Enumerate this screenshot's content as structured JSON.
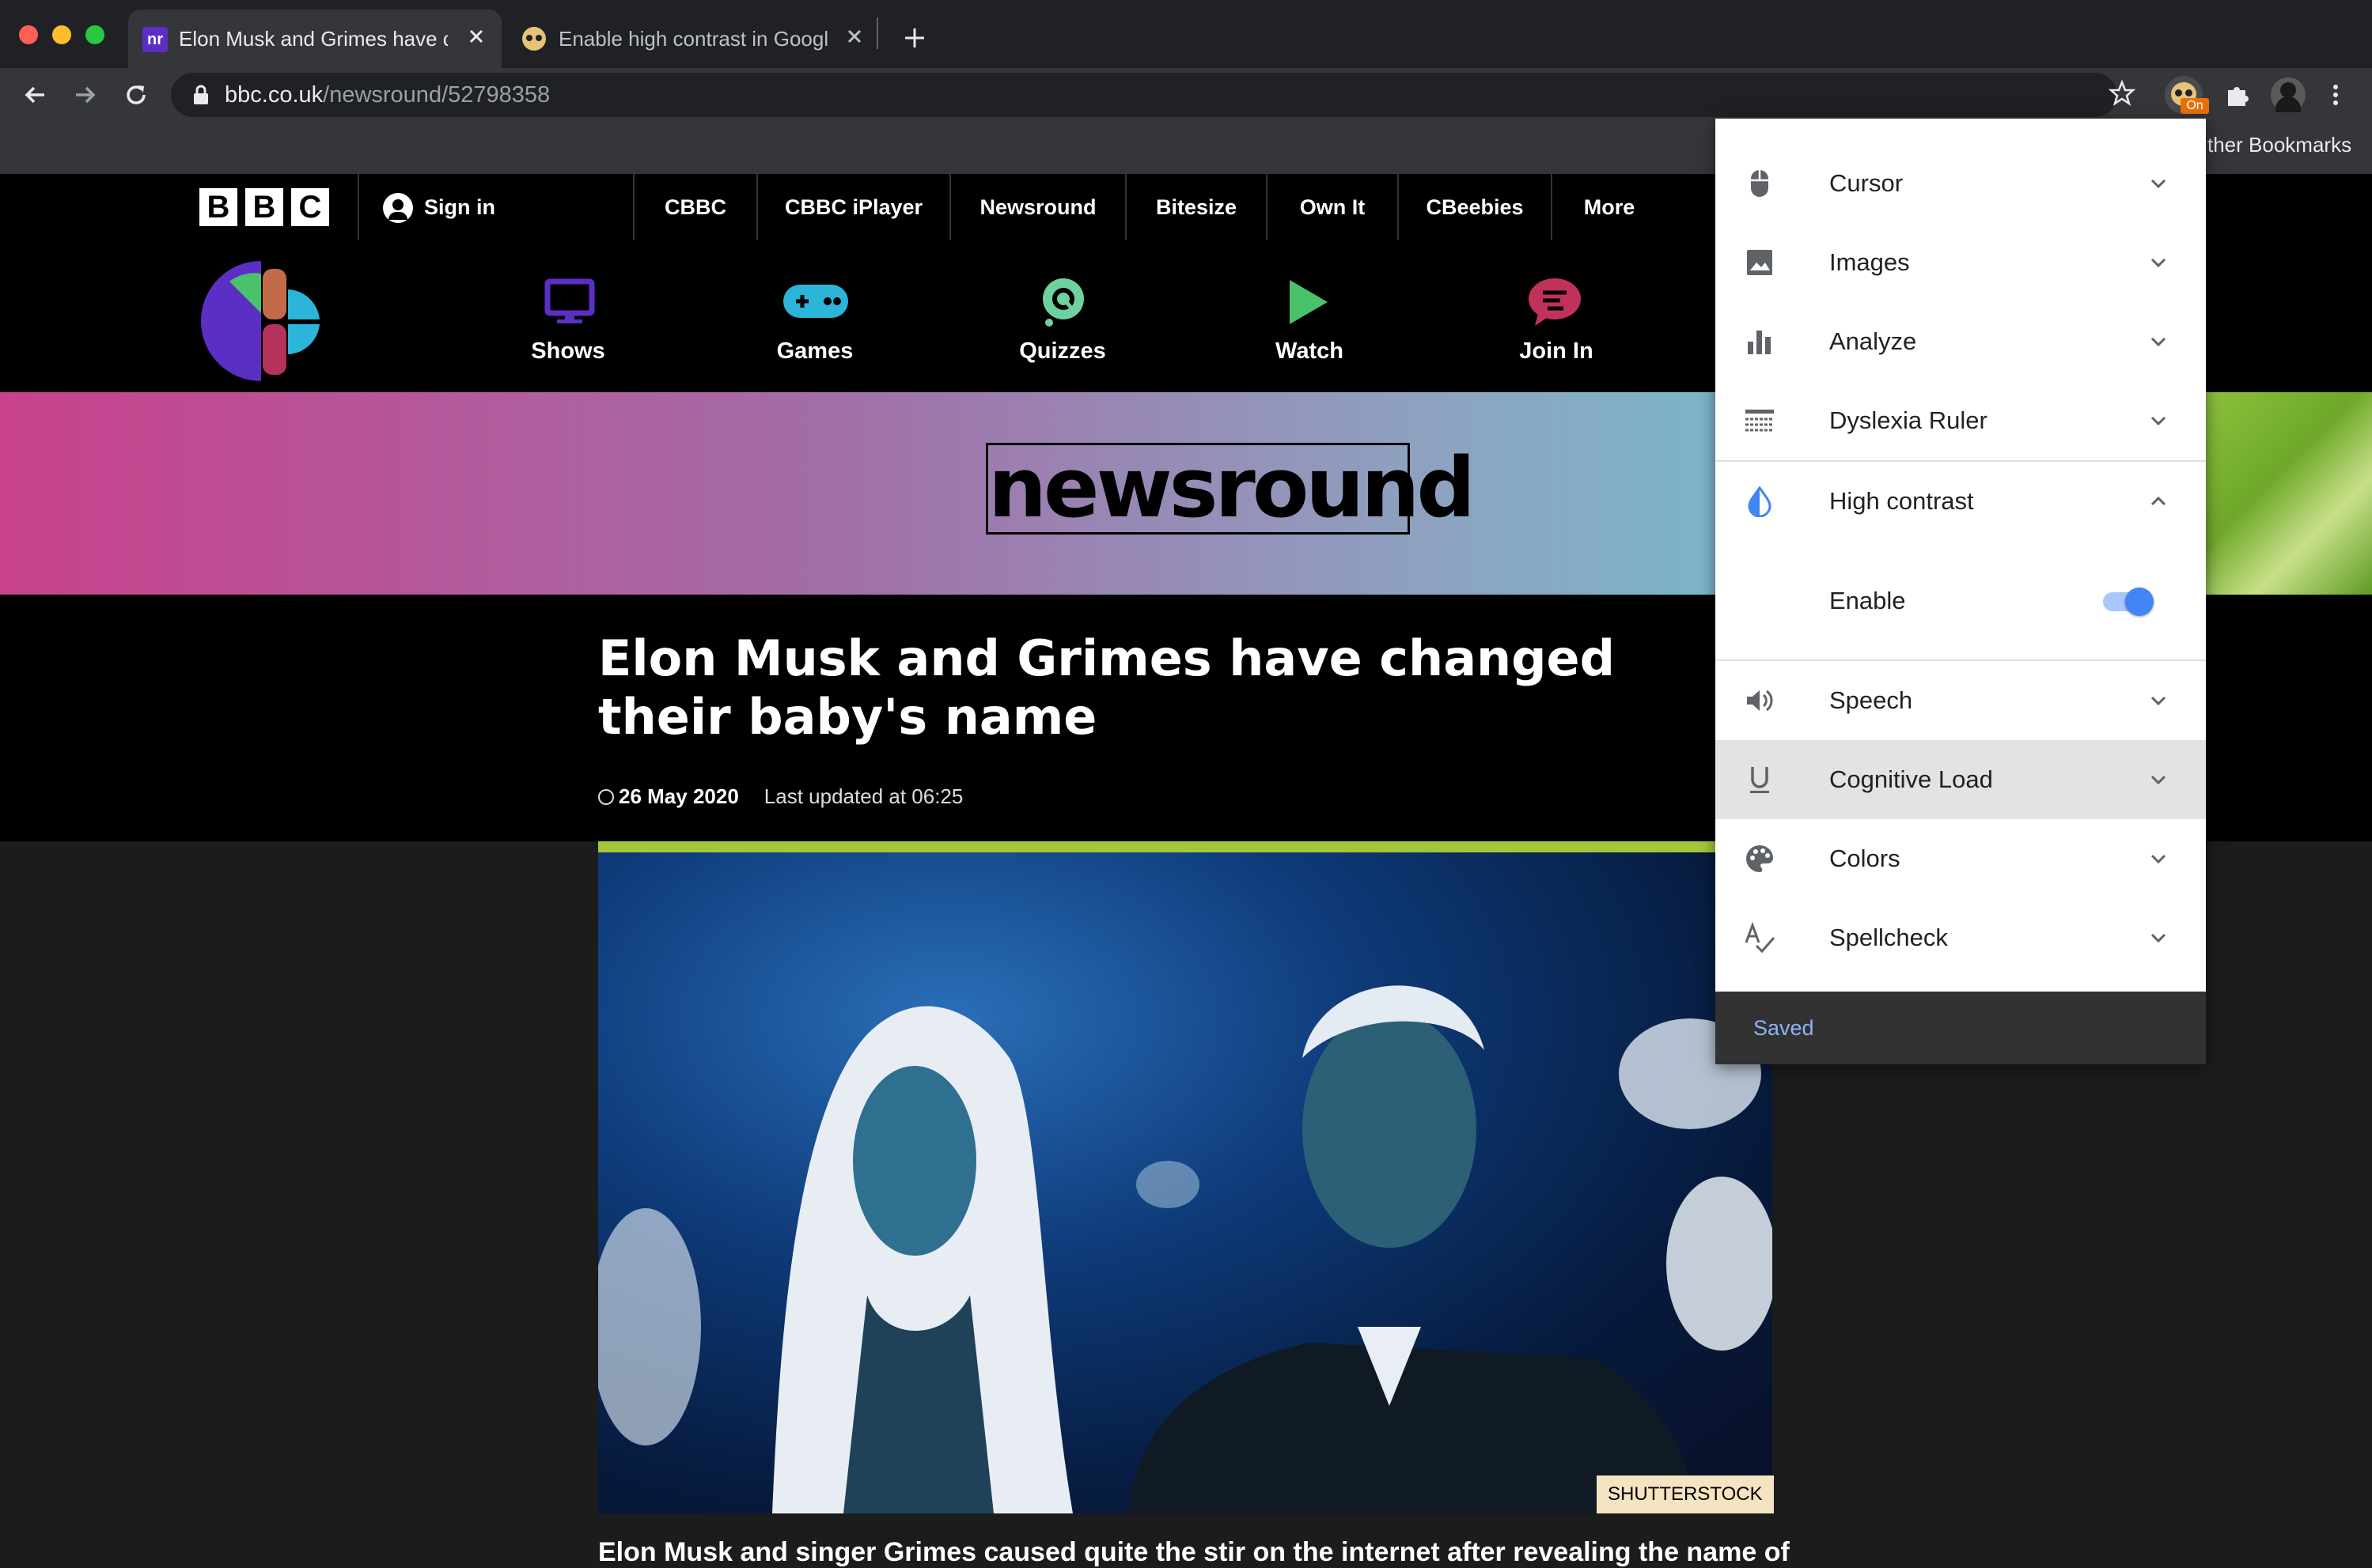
{
  "browser": {
    "tabs": [
      {
        "title": "Elon Musk and Grimes have changed their baby's name",
        "favicon": "newsround-favicon",
        "active": true
      },
      {
        "title": "Enable high contrast in Google Chrome",
        "favicon": "helperbird-favicon",
        "active": false
      }
    ],
    "url_domain": "bbc.co.uk",
    "url_path": "/newsround/52798358",
    "extension_badge": "On",
    "bookmarks_label": "ther Bookmarks"
  },
  "bbc_bar": {
    "logo_letters": [
      "B",
      "B",
      "C"
    ],
    "signin": "Sign in",
    "links": [
      "CBBC",
      "CBBC iPlayer",
      "Newsround",
      "Bitesize",
      "Own It",
      "CBeebies",
      "More"
    ]
  },
  "cbbc_nav": {
    "items": [
      {
        "label": "Shows",
        "icon": "tv-icon",
        "color": "#5b2fc4"
      },
      {
        "label": "Games",
        "icon": "gamepad-icon",
        "color": "#2bb5d8"
      },
      {
        "label": "Quizzes",
        "icon": "quiz-icon",
        "color": "#6fd1a0"
      },
      {
        "label": "Watch",
        "icon": "play-icon",
        "color": "#4ac26b"
      },
      {
        "label": "Join In",
        "icon": "chat-icon",
        "color": "#c0325a"
      }
    ]
  },
  "banner": {
    "title": "newsround"
  },
  "article": {
    "headline": "Elon Musk and Grimes have changed their baby's name",
    "date": "26 May 2020",
    "updated": "Last updated at 06:25",
    "image_credit": "SHUTTERSTOCK",
    "body_start": "Elon Musk and singer Grimes caused quite the stir on the internet after revealing the name of"
  },
  "panel": {
    "items": [
      {
        "label": "Cursor",
        "icon": "mouse-icon"
      },
      {
        "label": "Images",
        "icon": "image-icon"
      },
      {
        "label": "Analyze",
        "icon": "bar-chart-icon"
      },
      {
        "label": "Dyslexia Ruler",
        "icon": "ruler-icon"
      },
      {
        "label": "High contrast",
        "icon": "contrast-drop-icon",
        "expanded": true
      },
      {
        "label": "Speech",
        "icon": "speaker-icon"
      },
      {
        "label": "Cognitive Load",
        "icon": "underline-icon",
        "highlighted": true
      },
      {
        "label": "Colors",
        "icon": "palette-icon"
      },
      {
        "label": "Spellcheck",
        "icon": "spellcheck-icon"
      }
    ],
    "enable_label": "Enable",
    "enable_on": true,
    "footer_status": "Saved",
    "accent_color": "#4285f4"
  }
}
